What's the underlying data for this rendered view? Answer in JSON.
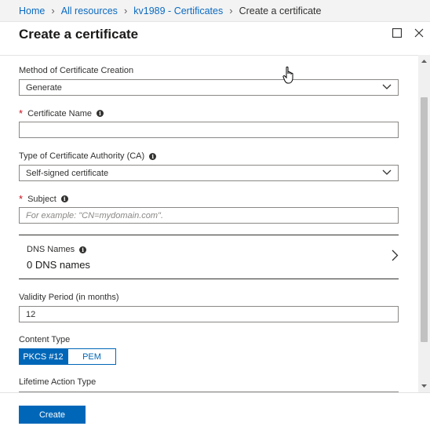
{
  "breadcrumb": {
    "items": [
      "Home",
      "All resources",
      "kv1989 - Certificates"
    ],
    "current": "Create a certificate"
  },
  "blade": {
    "title": "Create a certificate"
  },
  "form": {
    "method": {
      "label": "Method of Certificate Creation",
      "value": "Generate"
    },
    "certificate_name": {
      "label": "Certificate Name",
      "value": ""
    },
    "ca_type": {
      "label": "Type of Certificate Authority (CA)",
      "value": "Self-signed certificate"
    },
    "subject": {
      "label": "Subject",
      "placeholder": "For example: \"CN=mydomain.com\"."
    },
    "dns": {
      "label": "DNS Names",
      "value": "0 DNS names"
    },
    "validity": {
      "label": "Validity Period (in months)",
      "value": "12"
    },
    "content_type": {
      "label": "Content Type",
      "options": [
        "PKCS #12",
        "PEM"
      ],
      "selected": "PKCS #12"
    },
    "lifetime": {
      "label": "Lifetime Action Type"
    }
  },
  "footer": {
    "create_label": "Create"
  },
  "colors": {
    "accent": "#0067b8",
    "link": "#0b6ac0",
    "required": "#c50f1f"
  },
  "icons": [
    "chevron-right-icon",
    "maximize-icon",
    "close-icon",
    "info-icon",
    "chevron-down-icon",
    "hand-cursor-icon"
  ]
}
